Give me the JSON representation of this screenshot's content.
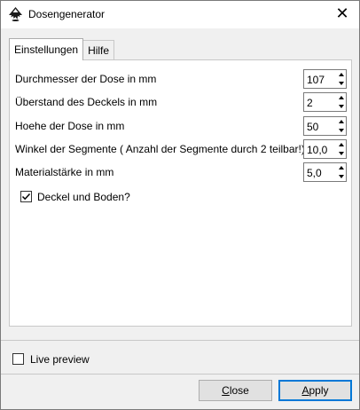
{
  "window": {
    "title": "Dosengenerator",
    "close_glyph": "✕"
  },
  "tabs": [
    {
      "label": "Einstellungen",
      "active": true
    },
    {
      "label": "Hilfe",
      "active": false
    }
  ],
  "settings": {
    "rows": [
      {
        "label": "Durchmesser der Dose in mm",
        "value": "107"
      },
      {
        "label": "Überstand des Deckels in mm",
        "value": "2"
      },
      {
        "label": "Hoehe der Dose in mm",
        "value": "50"
      },
      {
        "label": "Winkel der Segmente ( Anzahl der Segmente durch 2 teilbar!)",
        "value": "10,0"
      },
      {
        "label": "Materialstärke in mm",
        "value": "5,0"
      }
    ],
    "lid_and_bottom": {
      "label": "Deckel und Boden?",
      "checked": true
    }
  },
  "footer": {
    "live_preview": {
      "label": "Live preview",
      "checked": false
    },
    "close_first": "C",
    "close_rest": "lose",
    "apply_first": "A",
    "apply_rest": "pply"
  },
  "icons": {
    "app": "inkscape-logo-icon",
    "close": "close-icon"
  },
  "colors": {
    "accent": "#0078d7",
    "button_bg": "#e1e1e1",
    "window_bg": "#f0f0f0"
  }
}
